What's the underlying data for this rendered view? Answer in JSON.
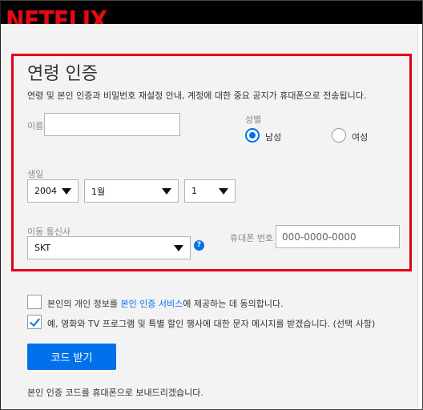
{
  "brand": {
    "logo_text": "NETFLIX",
    "logo_color": "#e50914"
  },
  "form": {
    "title": "연령 인증",
    "description": "연령 및 본인 인증과 비밀번호 재설정 안내, 계정에 대한 중요 공지가 휴대폰으로 전송됩니다.",
    "name_label": "이름",
    "name_value": "",
    "gender": {
      "label": "성별",
      "options": [
        "남성",
        "여성"
      ],
      "selected": "남성"
    },
    "birth": {
      "label": "생일",
      "year": "2004",
      "month": "1월",
      "day": "1"
    },
    "carrier": {
      "label": "이동 통신사",
      "value": "SKT",
      "help_symbol": "?"
    },
    "phone": {
      "label": "휴대폰 번호",
      "placeholder": "000-0000-0000"
    }
  },
  "consent": {
    "privacy": {
      "checked": false,
      "text_before": "본인의 개인 정보를 ",
      "link_text": "본인 인증 서비스",
      "text_after": "에 제공하는 데 동의합니다."
    },
    "marketing": {
      "checked": true,
      "text": "예, 영화와 TV 프로그램 및 특별 할인 행사에 대한 문자 메시지를 받겠습니다. (선택 사항)"
    }
  },
  "actions": {
    "submit_label": "코드 받기"
  },
  "footer_text": "본인 인증 코드를 휴대폰으로 보내드리겠습니다.",
  "colors": {
    "accent": "#0071eb",
    "highlight_border": "#e2001a"
  }
}
